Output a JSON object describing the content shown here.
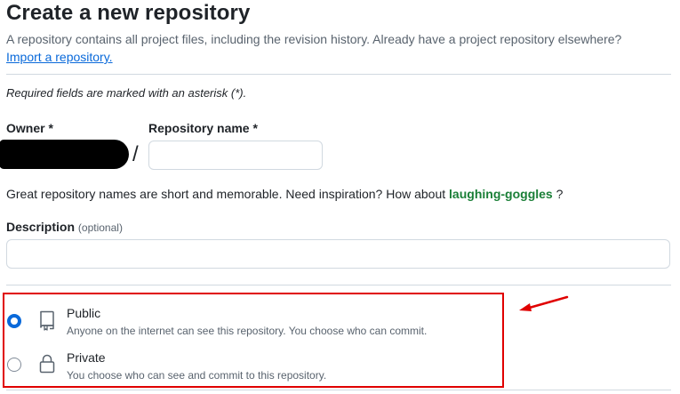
{
  "header": {
    "title": "Create a new repository",
    "subtitle": "A repository contains all project files, including the revision history. Already have a project repository elsewhere?",
    "import_link": "Import a repository."
  },
  "form": {
    "required_note": "Required fields are marked with an asterisk (*).",
    "owner_label": "Owner *",
    "repo_name_label": "Repository name *",
    "repo_name_value": "",
    "slash": "/",
    "hint_prefix": "Great repository names are short and memorable. Need inspiration? How about",
    "hint_suggestion": "laughing-goggles",
    "hint_suffix": "?",
    "description_label": "Description",
    "description_optional": "(optional)",
    "description_value": ""
  },
  "visibility": {
    "options": [
      {
        "title": "Public",
        "description": "Anyone on the internet can see this repository. You choose who can commit.",
        "icon": "repo-book-icon",
        "selected": true
      },
      {
        "title": "Private",
        "description": "You choose who can see and commit to this repository.",
        "icon": "lock-icon",
        "selected": false
      }
    ]
  },
  "annotation": {
    "box_color": "#e00000",
    "arrow_color": "#e00000"
  },
  "colors": {
    "link": "#0969da",
    "suggestion": "#1a7f37",
    "radio_checked": "#0969da"
  }
}
